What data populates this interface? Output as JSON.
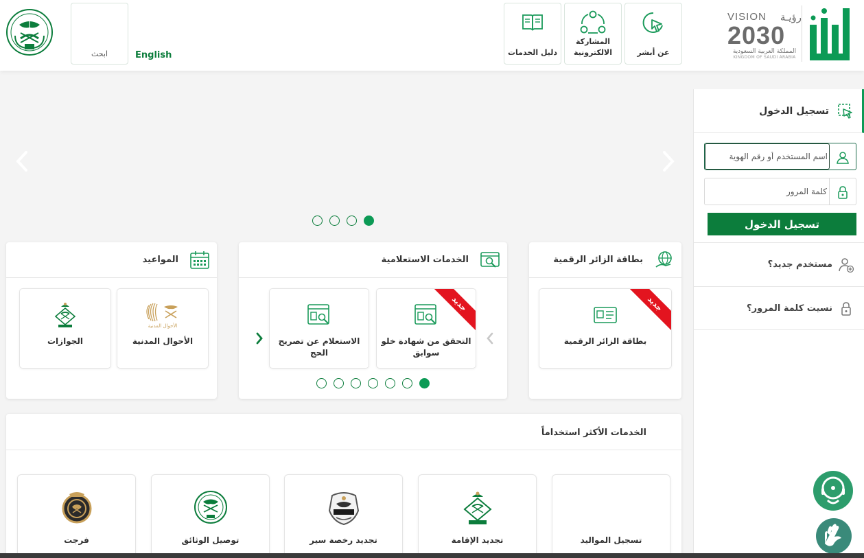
{
  "header": {
    "nav": [
      {
        "id": "about",
        "label": "عن أبشر"
      },
      {
        "id": "eparticipation",
        "label": "المشاركة الالكترونية"
      },
      {
        "id": "guide",
        "label": "دليل الخدمات"
      }
    ],
    "search_label": "ابحث",
    "language_link": "English",
    "vision": {
      "top_left": "VISION",
      "top_right": "رؤيـة",
      "year": "2030",
      "sub_ar": "المملكة العربية السعودية",
      "sub_en": "KINGDOM OF SAUDI ARABIA"
    }
  },
  "colors": {
    "brand_green": "#0c7d3c",
    "accent_green": "#0c9a55",
    "ribbon_red": "#e3141f"
  },
  "hero": {
    "dots_count": 4,
    "active_dot": 3
  },
  "cards": {
    "visitor": {
      "title": "بطاقة الزائر الرقمية",
      "tiles": [
        {
          "label": "بطاقة الزائر الرقمية",
          "badge": "جديد"
        }
      ]
    },
    "inquiry": {
      "title": "الخدمات الاستعلامية",
      "tiles": [
        {
          "label": "التحقق من شهادة خلو سوابق",
          "badge": "جديد"
        },
        {
          "label": "الاستعلام عن تصريح الحج"
        }
      ],
      "dots_count": 7,
      "active_dot": 6
    },
    "appointments": {
      "title": "المواعيد",
      "tiles": [
        {
          "label": "الأحوال المدنية",
          "logo_text": "الأحوال المدنية"
        },
        {
          "label": "الجوازات"
        }
      ]
    }
  },
  "most_used": {
    "title": "الخدمات الأكثر استخداماً",
    "tiles": [
      {
        "label": "تسجيل المواليد"
      },
      {
        "label": "تجديد الإقامة"
      },
      {
        "label": "تجديد رخصة سير"
      },
      {
        "label": "توصيل الوثائق"
      },
      {
        "label": "فرجت"
      }
    ]
  },
  "login": {
    "tab_title": "تسجيل الدخول",
    "username_placeholder": "اسم المستخدم أو رقم الهوية",
    "password_placeholder": "كلمة المرور",
    "submit_label": "تسجيل الدخول",
    "new_user": "مستخدم جديد؟",
    "forgot_password": "نسيت كلمة المرور؟"
  }
}
